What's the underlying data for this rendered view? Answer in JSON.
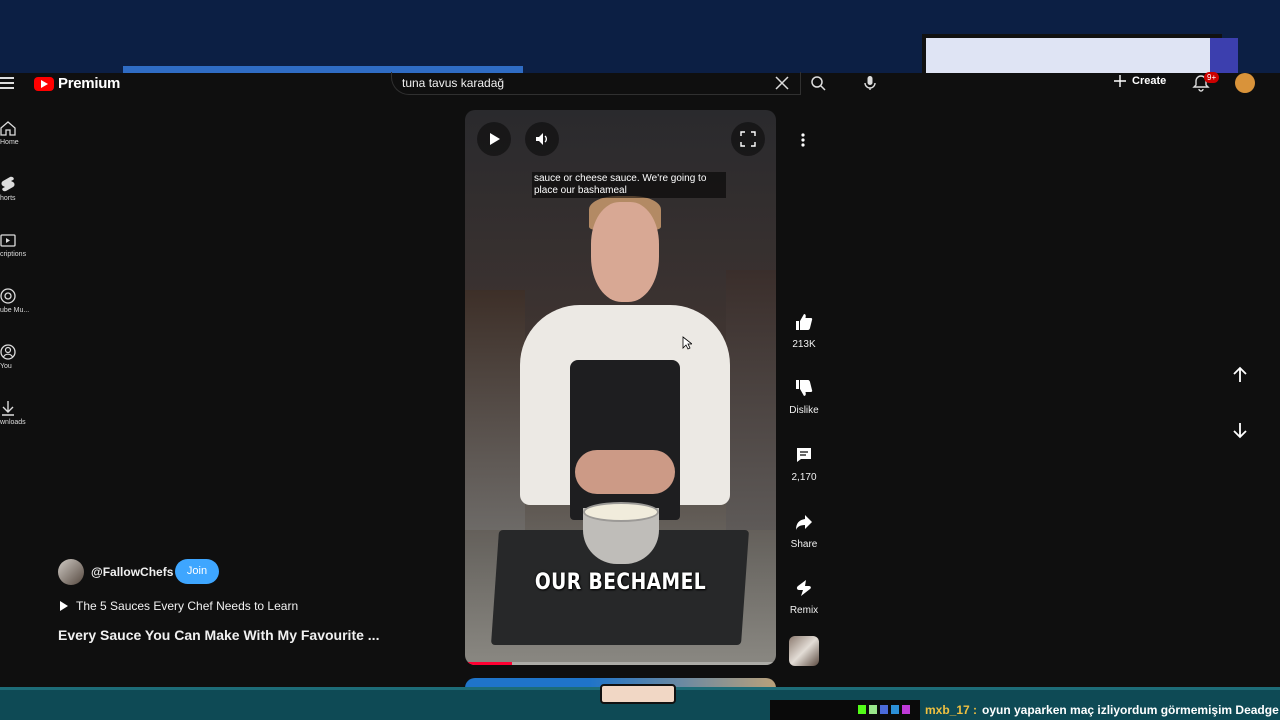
{
  "header": {
    "logo_text": "Premium",
    "search_value": "tuna tavus karadağ",
    "create_label": "Create",
    "notification_count": "9+"
  },
  "sidebar": {
    "items": [
      {
        "label": "Home",
        "icon": "home-icon"
      },
      {
        "label": "horts",
        "icon": "shorts-icon"
      },
      {
        "label": "criptions",
        "icon": "subscriptions-icon"
      },
      {
        "label": "ube Mu...",
        "icon": "music-icon"
      },
      {
        "label": "You",
        "icon": "you-icon"
      },
      {
        "label": "wnloads",
        "icon": "downloads-icon"
      }
    ]
  },
  "video": {
    "caption_top": "sauce or cheese sauce. We're going to place our bashameal",
    "caption_big": "OUR BECHAMEL",
    "progress_fraction": 0.15
  },
  "actions": {
    "likes": "213K",
    "dislike_label": "Dislike",
    "comments": "2,170",
    "share_label": "Share",
    "remix_label": "Remix"
  },
  "channel": {
    "handle": "@FallowChefs",
    "join_label": "Join",
    "playlist_title": "The 5 Sauces Every Chef Needs to Learn",
    "video_title": "Every Sauce You Can Make With My Favourite ..."
  },
  "chat": {
    "username": "mxb_17 :",
    "message": "oyun yaparken maç izliyordum görmemişim Deadge"
  },
  "colors": {
    "accent": "#ff0000",
    "join": "#3ea6ff",
    "overlay": "#0c1f44",
    "chat_bar": "#0e4a55"
  }
}
